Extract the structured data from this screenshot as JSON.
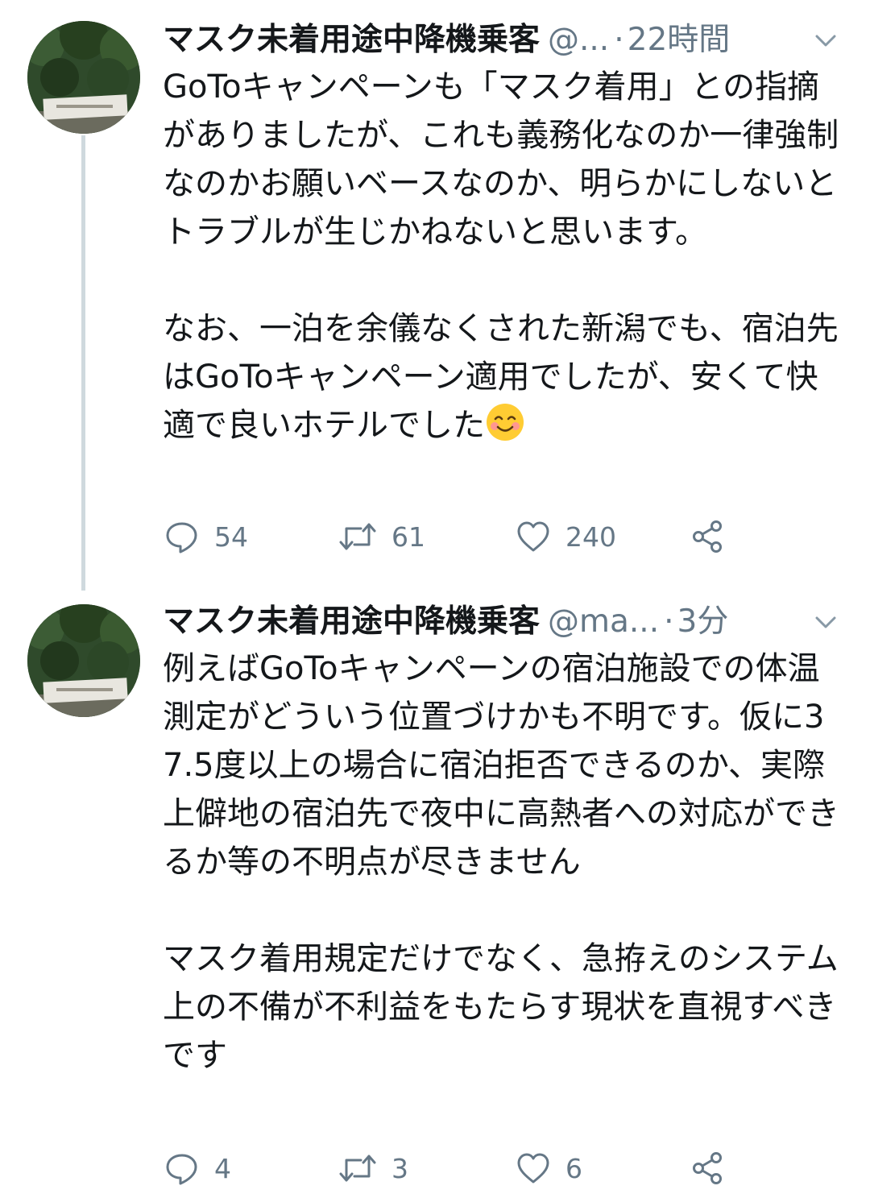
{
  "tweets": [
    {
      "display_name": "マスク未着用途中降機乗客",
      "handle": "@...",
      "separator": "·",
      "time": "22時間",
      "text": "GoToキャンペーンも「マスク着用」との指摘がありましたが、これも義務化なのか一律強制なのかお願いベースなのか、明らかにしないとトラブルが生じかねないと思います。\n\nなお、一泊を余儀なくされた新潟でも、宿泊先はGoToキャンペーン適用でしたが、安くて快適で良いホテルでした",
      "has_smile_emoji": true,
      "reply_count": "54",
      "retweet_count": "61",
      "like_count": "240"
    },
    {
      "display_name": "マスク未着用途中降機乗客",
      "handle": "@ma...",
      "separator": "·",
      "time": "3分",
      "text": "例えばGoToキャンペーンの宿泊施設での体温測定がどういう位置づけかも不明です。仮に37.5度以上の場合に宿泊拒否できるのか、実際上僻地の宿泊先で夜中に高熱者への対応ができるか等の不明点が尽きません\n\nマスク着用規定だけでなく、急拵えのシステム上の不備が不利益をもたらす現状を直視すべきです",
      "has_smile_emoji": false,
      "reply_count": "4",
      "retweet_count": "3",
      "like_count": "6"
    }
  ],
  "icons": {
    "reply": "reply-icon",
    "retweet": "retweet-icon",
    "like": "like-icon",
    "share": "share-icon",
    "caret": "chevron-down-icon",
    "emoji": "smiling-face-emoji"
  },
  "colors": {
    "text": "#14171a",
    "secondary": "#657786",
    "thread_line": "#cfd9de",
    "avatar_foliage": "#2f4a2b"
  }
}
